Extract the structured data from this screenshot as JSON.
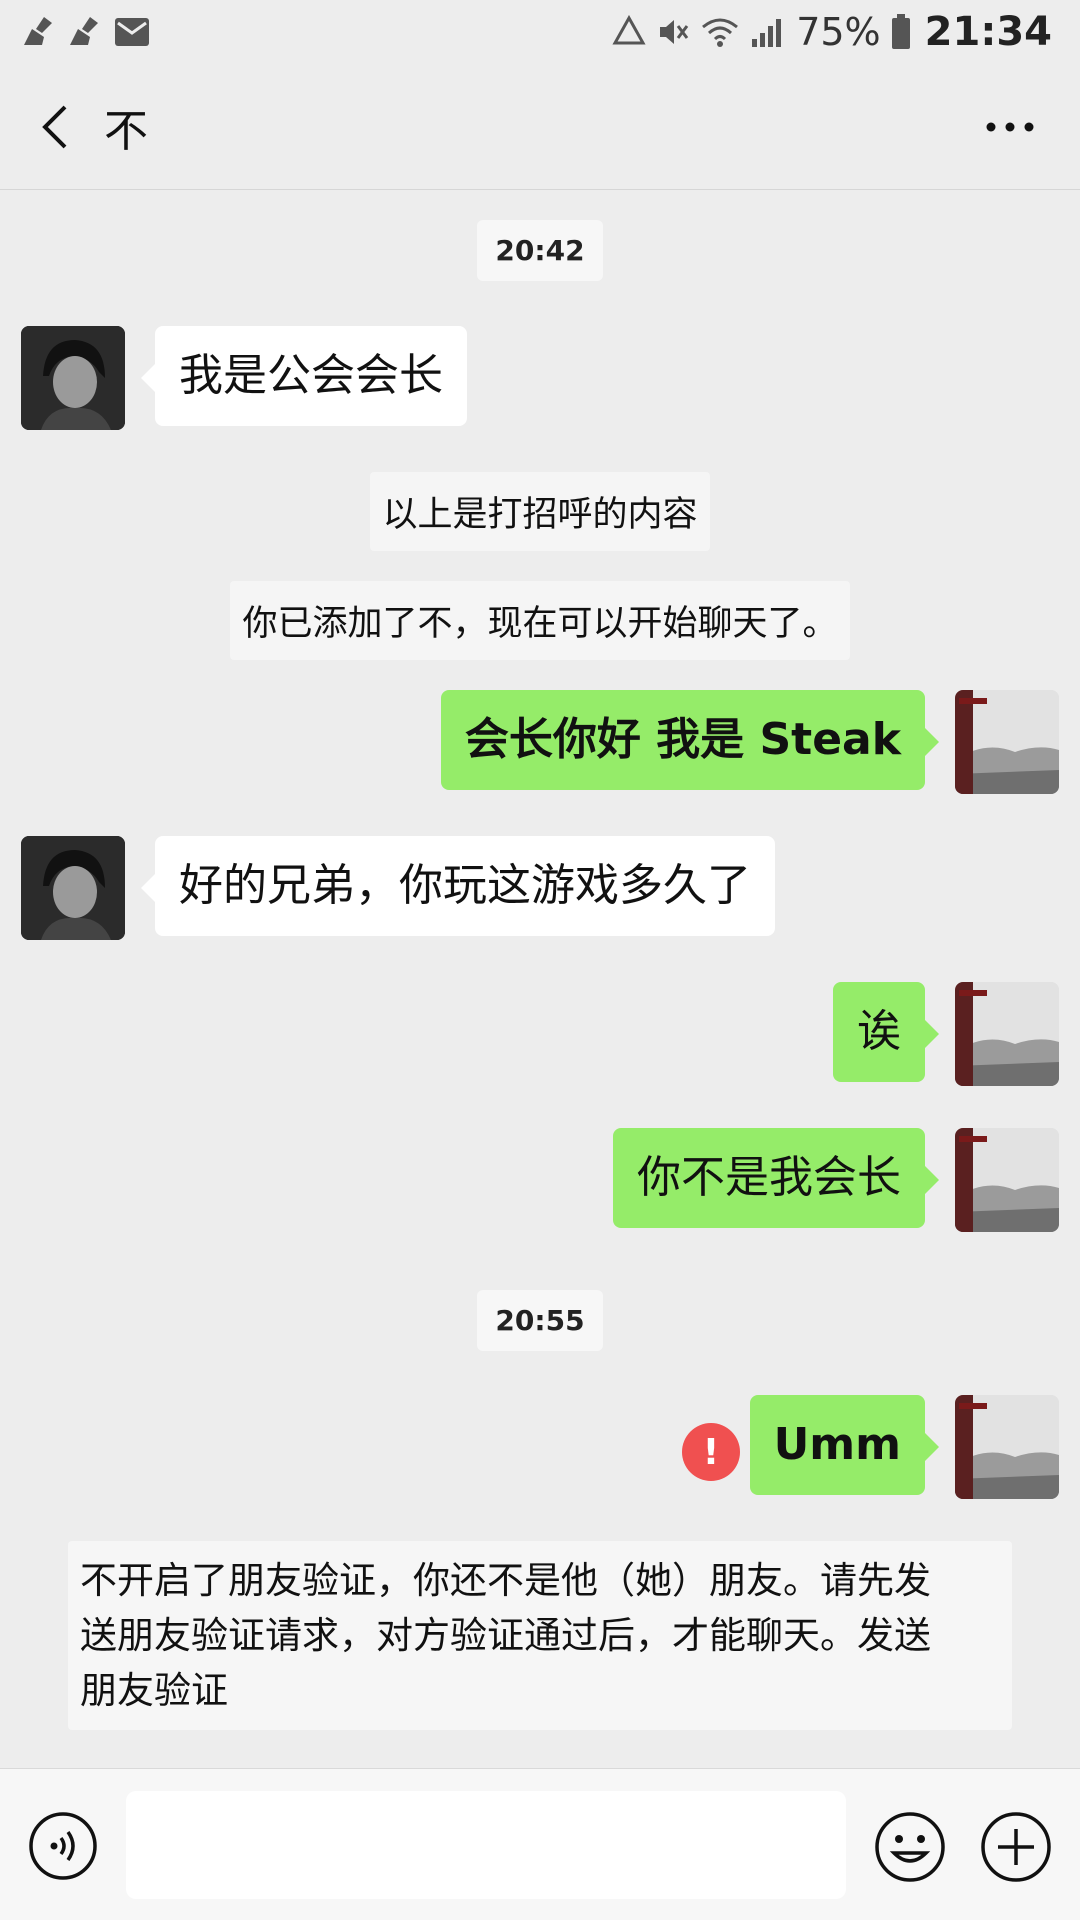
{
  "status_bar": {
    "battery_percent": "75%",
    "time": "21:34",
    "left_icons": [
      "broom-icon",
      "broom-icon",
      "mail-icon"
    ],
    "right_icons": [
      "recycle-icon",
      "mute-icon",
      "wifi-icon",
      "signal-icon",
      "battery-icon"
    ]
  },
  "header": {
    "title": "不"
  },
  "messages": {
    "timestamp_1": "20:42",
    "msg_1": "我是公会会长",
    "notice_1": "以上是打招呼的内容",
    "notice_2": "你已添加了不，现在可以开始聊天了。",
    "msg_2": "会长你好 我是 Steak",
    "msg_3": "好的兄弟，你玩这游戏多久了",
    "msg_4": "诶",
    "msg_5": "你不是我会长",
    "timestamp_2": "20:55",
    "msg_6": "Umm",
    "error_mark": "!",
    "notice_3_line1": "不开启了朋友验证，你还不是他（她）朋友。请先发",
    "notice_3_line2": "送朋友验证请求，对方验证通过后，才能聊天。发送",
    "notice_3_line3": "朋友验证"
  },
  "colors": {
    "background": "#ededed",
    "outgoing_bubble": "#95ec69",
    "incoming_bubble": "#ffffff",
    "error": "#f05050"
  }
}
